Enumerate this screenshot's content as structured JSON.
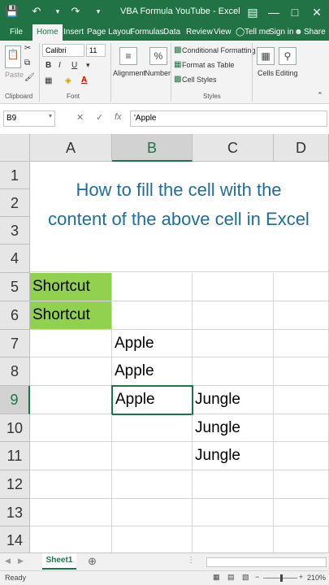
{
  "window": {
    "title": "VBA Formula YouTube - Excel",
    "accent": "#217346"
  },
  "ribbon_tabs": [
    "File",
    "Home",
    "Insert",
    "Page Layout",
    "Formulas",
    "Data",
    "Review",
    "View"
  ],
  "ribbon_right": {
    "tell_me": "Tell me",
    "sign_in": "Sign in",
    "share": "Share"
  },
  "ribbon": {
    "paste": "Paste",
    "font_name": "Calibri",
    "font_size": "11",
    "bold": "B",
    "italic": "I",
    "underline": "U",
    "font_color_glyph": "A",
    "alignment": "Alignment",
    "number": "Number",
    "conditional_formatting": "Conditional Formatting",
    "format_as_table": "Format as Table",
    "cell_styles": "Cell Styles",
    "cells": "Cells",
    "editing": "Editing",
    "groups": {
      "clipboard": "Clipboard",
      "font": "Font",
      "styles": "Styles"
    }
  },
  "formula_bar": {
    "name_box": "B9",
    "fx": "fx",
    "formula": "'Apple"
  },
  "grid": {
    "columns": [
      "A",
      "B",
      "C",
      "D"
    ],
    "selected_column": "B",
    "rows": [
      "1",
      "2",
      "3",
      "4",
      "5",
      "6",
      "7",
      "8",
      "9",
      "10",
      "11",
      "12",
      "13",
      "14"
    ],
    "selected_row": "9",
    "heading_line1": "How to fill the cell with the",
    "heading_line2": "content of the above cell in Excel",
    "cells": {
      "A5": "Shortcut",
      "A6": "Shortcut",
      "B7": "Apple",
      "B8": "Apple",
      "B9": "Apple",
      "C9": "Jungle",
      "C10": "Jungle",
      "C11": "Jungle"
    },
    "highlight_color": "#92d050",
    "heading_color": "#1f6e9a"
  },
  "sheet_tabs": [
    "Sheet1"
  ],
  "status": {
    "ready": "Ready",
    "zoom": "210%"
  }
}
